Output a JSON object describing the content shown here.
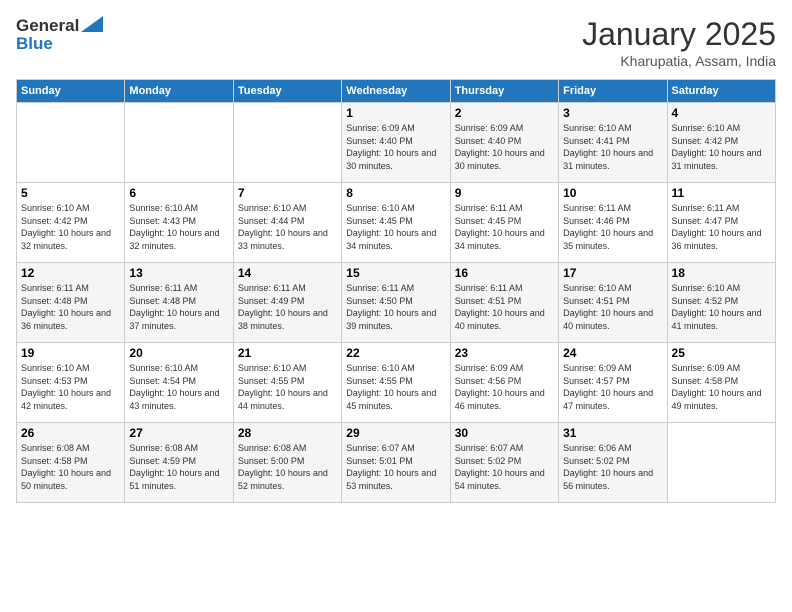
{
  "logo": {
    "line1": "General",
    "line2": "Blue"
  },
  "title": "January 2025",
  "subtitle": "Kharupatia, Assam, India",
  "weekdays": [
    "Sunday",
    "Monday",
    "Tuesday",
    "Wednesday",
    "Thursday",
    "Friday",
    "Saturday"
  ],
  "weeks": [
    [
      {
        "day": "",
        "sunrise": "",
        "sunset": "",
        "daylight": ""
      },
      {
        "day": "",
        "sunrise": "",
        "sunset": "",
        "daylight": ""
      },
      {
        "day": "",
        "sunrise": "",
        "sunset": "",
        "daylight": ""
      },
      {
        "day": "1",
        "sunrise": "Sunrise: 6:09 AM",
        "sunset": "Sunset: 4:40 PM",
        "daylight": "Daylight: 10 hours and 30 minutes."
      },
      {
        "day": "2",
        "sunrise": "Sunrise: 6:09 AM",
        "sunset": "Sunset: 4:40 PM",
        "daylight": "Daylight: 10 hours and 30 minutes."
      },
      {
        "day": "3",
        "sunrise": "Sunrise: 6:10 AM",
        "sunset": "Sunset: 4:41 PM",
        "daylight": "Daylight: 10 hours and 31 minutes."
      },
      {
        "day": "4",
        "sunrise": "Sunrise: 6:10 AM",
        "sunset": "Sunset: 4:42 PM",
        "daylight": "Daylight: 10 hours and 31 minutes."
      }
    ],
    [
      {
        "day": "5",
        "sunrise": "Sunrise: 6:10 AM",
        "sunset": "Sunset: 4:42 PM",
        "daylight": "Daylight: 10 hours and 32 minutes."
      },
      {
        "day": "6",
        "sunrise": "Sunrise: 6:10 AM",
        "sunset": "Sunset: 4:43 PM",
        "daylight": "Daylight: 10 hours and 32 minutes."
      },
      {
        "day": "7",
        "sunrise": "Sunrise: 6:10 AM",
        "sunset": "Sunset: 4:44 PM",
        "daylight": "Daylight: 10 hours and 33 minutes."
      },
      {
        "day": "8",
        "sunrise": "Sunrise: 6:10 AM",
        "sunset": "Sunset: 4:45 PM",
        "daylight": "Daylight: 10 hours and 34 minutes."
      },
      {
        "day": "9",
        "sunrise": "Sunrise: 6:11 AM",
        "sunset": "Sunset: 4:45 PM",
        "daylight": "Daylight: 10 hours and 34 minutes."
      },
      {
        "day": "10",
        "sunrise": "Sunrise: 6:11 AM",
        "sunset": "Sunset: 4:46 PM",
        "daylight": "Daylight: 10 hours and 35 minutes."
      },
      {
        "day": "11",
        "sunrise": "Sunrise: 6:11 AM",
        "sunset": "Sunset: 4:47 PM",
        "daylight": "Daylight: 10 hours and 36 minutes."
      }
    ],
    [
      {
        "day": "12",
        "sunrise": "Sunrise: 6:11 AM",
        "sunset": "Sunset: 4:48 PM",
        "daylight": "Daylight: 10 hours and 36 minutes."
      },
      {
        "day": "13",
        "sunrise": "Sunrise: 6:11 AM",
        "sunset": "Sunset: 4:48 PM",
        "daylight": "Daylight: 10 hours and 37 minutes."
      },
      {
        "day": "14",
        "sunrise": "Sunrise: 6:11 AM",
        "sunset": "Sunset: 4:49 PM",
        "daylight": "Daylight: 10 hours and 38 minutes."
      },
      {
        "day": "15",
        "sunrise": "Sunrise: 6:11 AM",
        "sunset": "Sunset: 4:50 PM",
        "daylight": "Daylight: 10 hours and 39 minutes."
      },
      {
        "day": "16",
        "sunrise": "Sunrise: 6:11 AM",
        "sunset": "Sunset: 4:51 PM",
        "daylight": "Daylight: 10 hours and 40 minutes."
      },
      {
        "day": "17",
        "sunrise": "Sunrise: 6:10 AM",
        "sunset": "Sunset: 4:51 PM",
        "daylight": "Daylight: 10 hours and 40 minutes."
      },
      {
        "day": "18",
        "sunrise": "Sunrise: 6:10 AM",
        "sunset": "Sunset: 4:52 PM",
        "daylight": "Daylight: 10 hours and 41 minutes."
      }
    ],
    [
      {
        "day": "19",
        "sunrise": "Sunrise: 6:10 AM",
        "sunset": "Sunset: 4:53 PM",
        "daylight": "Daylight: 10 hours and 42 minutes."
      },
      {
        "day": "20",
        "sunrise": "Sunrise: 6:10 AM",
        "sunset": "Sunset: 4:54 PM",
        "daylight": "Daylight: 10 hours and 43 minutes."
      },
      {
        "day": "21",
        "sunrise": "Sunrise: 6:10 AM",
        "sunset": "Sunset: 4:55 PM",
        "daylight": "Daylight: 10 hours and 44 minutes."
      },
      {
        "day": "22",
        "sunrise": "Sunrise: 6:10 AM",
        "sunset": "Sunset: 4:55 PM",
        "daylight": "Daylight: 10 hours and 45 minutes."
      },
      {
        "day": "23",
        "sunrise": "Sunrise: 6:09 AM",
        "sunset": "Sunset: 4:56 PM",
        "daylight": "Daylight: 10 hours and 46 minutes."
      },
      {
        "day": "24",
        "sunrise": "Sunrise: 6:09 AM",
        "sunset": "Sunset: 4:57 PM",
        "daylight": "Daylight: 10 hours and 47 minutes."
      },
      {
        "day": "25",
        "sunrise": "Sunrise: 6:09 AM",
        "sunset": "Sunset: 4:58 PM",
        "daylight": "Daylight: 10 hours and 49 minutes."
      }
    ],
    [
      {
        "day": "26",
        "sunrise": "Sunrise: 6:08 AM",
        "sunset": "Sunset: 4:58 PM",
        "daylight": "Daylight: 10 hours and 50 minutes."
      },
      {
        "day": "27",
        "sunrise": "Sunrise: 6:08 AM",
        "sunset": "Sunset: 4:59 PM",
        "daylight": "Daylight: 10 hours and 51 minutes."
      },
      {
        "day": "28",
        "sunrise": "Sunrise: 6:08 AM",
        "sunset": "Sunset: 5:00 PM",
        "daylight": "Daylight: 10 hours and 52 minutes."
      },
      {
        "day": "29",
        "sunrise": "Sunrise: 6:07 AM",
        "sunset": "Sunset: 5:01 PM",
        "daylight": "Daylight: 10 hours and 53 minutes."
      },
      {
        "day": "30",
        "sunrise": "Sunrise: 6:07 AM",
        "sunset": "Sunset: 5:02 PM",
        "daylight": "Daylight: 10 hours and 54 minutes."
      },
      {
        "day": "31",
        "sunrise": "Sunrise: 6:06 AM",
        "sunset": "Sunset: 5:02 PM",
        "daylight": "Daylight: 10 hours and 56 minutes."
      },
      {
        "day": "",
        "sunrise": "",
        "sunset": "",
        "daylight": ""
      }
    ]
  ]
}
